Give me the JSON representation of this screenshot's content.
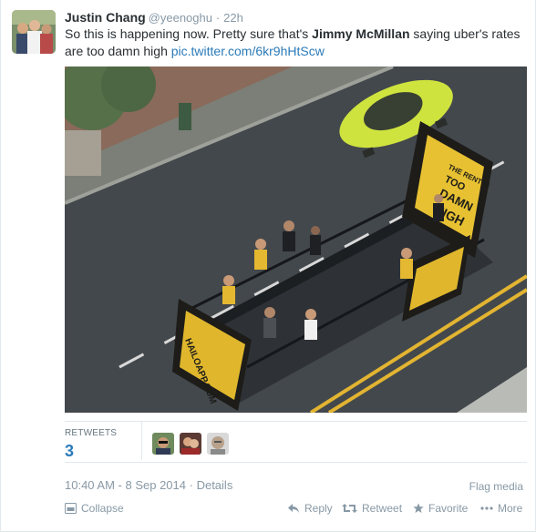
{
  "tweet": {
    "fullname": "Justin Chang",
    "username": "@yeenoghu",
    "separator": "·",
    "time_ago": "22h",
    "text_before": "So this is happening now. Pretty sure that's ",
    "text_bold": "Jimmy McMillan",
    "text_after": " saying uber's rates are too damn high ",
    "link": "pic.twitter.com/6kr9hHtScw"
  },
  "media": {
    "truck_sign_1": "THE RENT IS",
    "truck_sign_2": "TOO",
    "truck_sign_3": "DAMN",
    "truck_sign_4": "HIGH",
    "truck_side_1": "HAILOAPP.COM",
    "truck_side_2": "HAILO"
  },
  "stats": {
    "retweets_label": "RETWEETS",
    "retweets_count": "3"
  },
  "meta": {
    "timestamp": "10:40 AM - 8 Sep 2014",
    "separator": "·",
    "details": "Details",
    "flag_media": "Flag media"
  },
  "actions": {
    "collapse": "Collapse",
    "reply": "Reply",
    "retweet": "Retweet",
    "favorite": "Favorite",
    "more": "More"
  },
  "colors": {
    "link": "#2b7bb9",
    "muted": "#8899a6",
    "text": "#292f33",
    "divider": "#e1e8ed"
  },
  "icons": [
    "collapse-icon",
    "reply-icon",
    "retweet-icon",
    "favorite-star-icon",
    "more-dots-icon"
  ]
}
